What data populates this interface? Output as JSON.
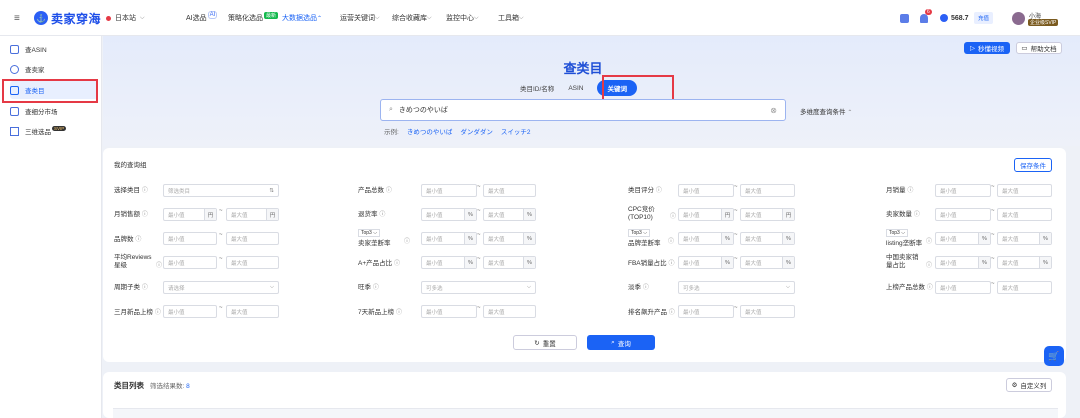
{
  "topbar": {
    "logo_text": "卖家穿海",
    "site": "日本站",
    "nav": [
      {
        "label": "AI选品",
        "tag": "AI"
      },
      {
        "label": "策略化选品",
        "badge": "最新"
      },
      {
        "label": "大数据选品"
      },
      {
        "label": "运营关键词"
      },
      {
        "label": "综合收藏库"
      },
      {
        "label": "监控中心"
      },
      {
        "label": "工具箱"
      }
    ],
    "notif_count": "6",
    "balance": "568.7",
    "recharge": "充值",
    "user_name": "小海",
    "user_level": "企业级SVIP"
  },
  "sidebar": {
    "items": [
      {
        "label": "查ASIN"
      },
      {
        "label": "查卖家"
      },
      {
        "label": "查类目"
      },
      {
        "label": "查细分市场"
      },
      {
        "label": "三维选品",
        "badge": "SVIP"
      }
    ]
  },
  "hero": {
    "title": "查类目",
    "tabs": [
      "类目ID/名称",
      "ASIN",
      "关键词"
    ],
    "search_value": "きめつのやいば",
    "multi_query": "多维度查询条件",
    "examples_label": "示例:",
    "examples": [
      "きめつのやいば",
      "ダンダダン",
      "スイッチ2"
    ],
    "video_btn": "秒懂视频",
    "help_btn": "帮助文档"
  },
  "filters": {
    "group_title": "我的查询组",
    "save_btn": "保存条件",
    "min_ph": "最小值",
    "max_ph": "最大值",
    "choose_category_ph": "筛选类目",
    "select_ph": "请选择",
    "selectable_ph": "可多选",
    "top3": "Top3",
    "rows": {
      "r1": [
        "选择类目",
        "产品总数",
        "类目评分",
        "月销量"
      ],
      "r2": [
        "月销售额",
        "退货率",
        "CPC竞价(TOP10)",
        "卖家数量"
      ],
      "r3": [
        "品牌数",
        "卖家垄断率",
        "品牌垄断率",
        "listing垄断率"
      ],
      "r4": [
        "平均Reviews星级",
        "A+产品占比",
        "FBA销量占比",
        "中国卖家销量占比"
      ],
      "r5": [
        "周期子类",
        "旺季",
        "淡季",
        "上榜产品总数"
      ],
      "r6": [
        "三月新品上榜",
        "7天新品上榜",
        "排名飙升产品"
      ]
    },
    "unit_yen": "円",
    "unit_pct": "%",
    "reset_btn": "重置",
    "query_btn": "查询"
  },
  "results": {
    "title": "类目列表",
    "count_label": "筛选结果数:",
    "count": "8",
    "custom_btn": "自定义列"
  }
}
